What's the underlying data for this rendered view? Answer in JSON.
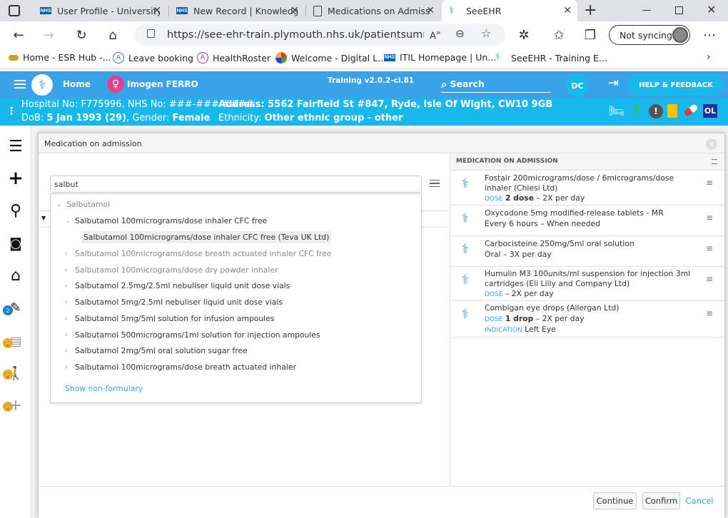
{
  "tabs": [
    {
      "title": "User Profile - University",
      "favicon": "nhs-logo"
    },
    {
      "title": "New Record | Knowledg",
      "favicon": "nhs-logo"
    },
    {
      "title": "Medications on Admiss",
      "favicon": "document-icon"
    },
    {
      "title": "SeeEHR",
      "favicon": "seeehr-logo",
      "active": true
    }
  ],
  "browser": {
    "url": "https://see-ehr-train.plymouth.nhs.uk/patientsummary/...",
    "sync_label": "Not syncing"
  },
  "bookmarks": [
    "Home - ESR Hub -...",
    "Leave booking",
    "HealthRoster",
    "Welcome - Digital L...",
    "ITIL Homepage | Un...",
    "SeeEHR - Training E..."
  ],
  "app": {
    "home": "Home",
    "patient": "Imogen FERRO",
    "version": "Training v2.0.2-ci.81",
    "search": "Search",
    "user_initials": "DC",
    "help": "HELP & FEEDBACK",
    "ol_badge": "OL",
    "alert_badge_count": "2",
    "line1": "Hospital No: F775996, NHS No: ###-###-####",
    "line2_dob": "DoB: ",
    "dob": "5 Jan 1993 (29)",
    "gender_label": ", Gender: ",
    "gender": "Female",
    "address": "Address: 5562 Fairfield St #847, Ryde, Isle Of Wight, CW10 9GB",
    "ethnicity_label": "Ethnicity: ",
    "ethnicity": "Other ethnic group - other"
  },
  "modal": {
    "title": "Medication on admission",
    "search_value": "salbut",
    "dropdown": {
      "group": "Salbutamol",
      "items": [
        {
          "label": "Salbutamol 100micrograms/dose inhaler CFC free",
          "expanded": true
        },
        {
          "label": "Salbutamol 100micrograms/dose inhaler CFC free (Teva UK Ltd)",
          "child": true,
          "selected": true
        },
        {
          "label": "Salbutamol 100micrograms/dose breath actuated inhaler CFC free",
          "muted": true
        },
        {
          "label": "Salbutamol 100micrograms/dose dry powder inhaler",
          "muted": true
        },
        {
          "label": "Salbutamol 2.5mg/2.5ml nebuliser liquid unit dose vials"
        },
        {
          "label": "Salbutamol 5mg/2.5ml nebuliser liquid unit dose vials"
        },
        {
          "label": "Salbutamol 5mg/5ml solution for infusion ampoules"
        },
        {
          "label": "Salbutamol 500micrograms/1ml solution for injection ampoules"
        },
        {
          "label": "Salbutamol 2mg/5ml oral solution sugar free"
        },
        {
          "label": "Salbutamol 100micrograms/dose breath actuated inhaler"
        }
      ],
      "show_more": "Show non-formulary"
    },
    "right_title": "MEDICATION ON ADMISSION",
    "meds": [
      {
        "name": "Fostair 200micrograms/dose / 6micrograms/dose inhaler (Chiesi Ltd)",
        "dose_label": "DOSE",
        "dose": "2 dose",
        "freq": " – 2X per day"
      },
      {
        "name": "Oxycodone 5mg modified-release tablets - MR",
        "detail": "Every 6 hours – When needed"
      },
      {
        "name": "Carbocisteine 250mg/5ml oral solution",
        "detail": "Oral – 3X per day"
      },
      {
        "name": "Humulin M3 100units/ml suspension for injection 3ml cartridges (Eli Lilly and Company Ltd)",
        "dose_label": "DOSE",
        "freq": " – 2X per day"
      },
      {
        "name": "Combigan eye drops (Allergan Ltd)",
        "dose_label": "DOSE",
        "dose": "1 drop",
        "freq": " – 2X per day",
        "indication_label": "INDICATION",
        "indication": "Left Eye"
      }
    ],
    "buttons": {
      "continue": "Continue",
      "confirm": "Confirm",
      "cancel": "Cancel"
    }
  },
  "colors": {
    "app_header": "#3aa2e8",
    "patient_banner": "#19b8ea",
    "link": "#3aa2e8"
  }
}
